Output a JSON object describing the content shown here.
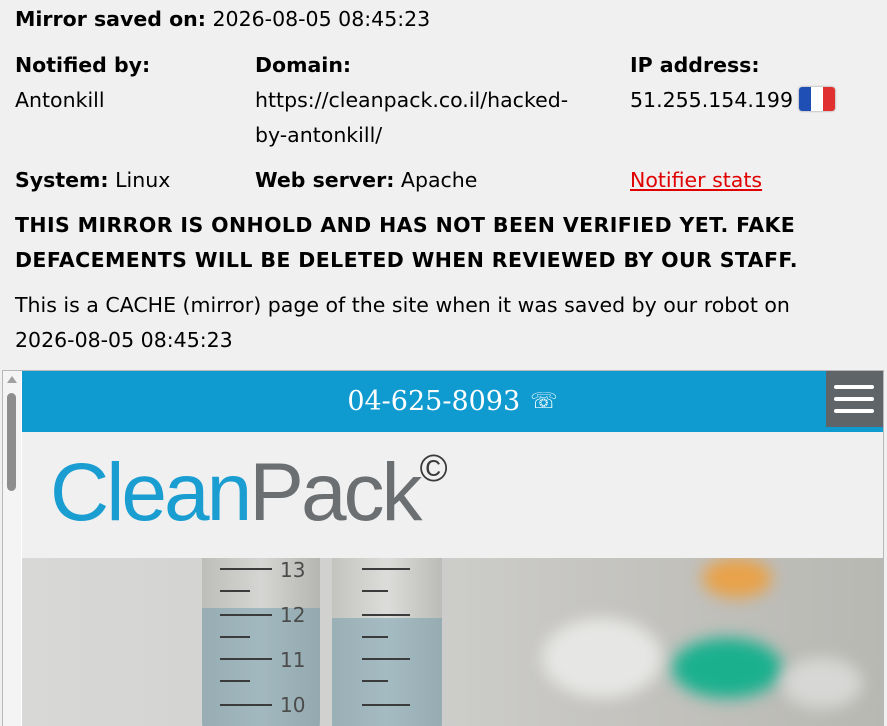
{
  "mirror": {
    "saved_label": "Mirror saved on:",
    "saved_value": "2026-08-05 08:45:23"
  },
  "meta": {
    "notified_by_label": "Notified by:",
    "notified_by_value": "Antonkill",
    "domain_label": "Domain:",
    "domain_line1": "https://cleanpack.co.il/hacked-",
    "domain_line2": "by-antonkill/",
    "ip_label": "IP address:",
    "ip_value": "51.255.154.199",
    "flag_icon": "france-flag-icon",
    "system_label": "System:",
    "system_value": "Linux",
    "webserver_label": "Web server:",
    "webserver_value": "Apache",
    "notifier_stats_link": "Notifier stats"
  },
  "warning": {
    "line1": "THIS MIRROR IS ONHOLD AND HAS NOT BEEN VERIFIED YET. FAKE",
    "line2": "DEFACEMENTS WILL BE DELETED WHEN REVIEWED BY OUR STAFF."
  },
  "cache_note": {
    "line1": "This is a CACHE (mirror) page of the site when it was saved by our robot on",
    "line2": "2026-08-05 08:45:23"
  },
  "site": {
    "phone": "04-625-8093",
    "phone_icon": "☏",
    "logo_part1": "Clean",
    "logo_part2": "Pack",
    "logo_mark": "©",
    "colors": {
      "topbar": "#0f9bd0",
      "logo_blue": "#1a9ed2",
      "logo_gray": "#6b6f72",
      "link_red": "#e00000"
    },
    "hero_numbers": [
      "13",
      "12",
      "11",
      "10"
    ]
  }
}
